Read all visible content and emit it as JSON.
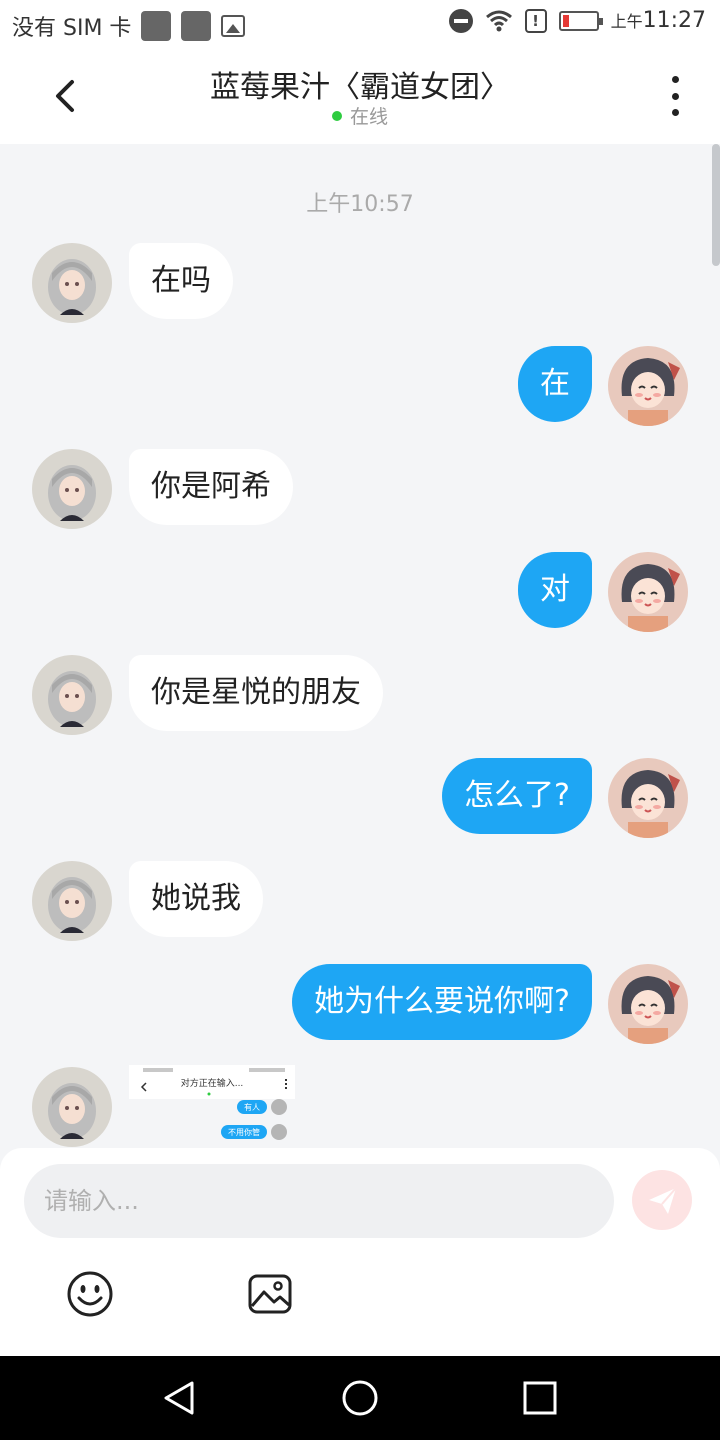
{
  "status_bar": {
    "carrier": "没有 SIM 卡",
    "ampm": "上午",
    "time": "11:27",
    "battery_color": "#e53935",
    "icons": [
      "sim-placeholder-icon",
      "sim-placeholder-icon",
      "image-icon",
      "do-not-disturb-icon",
      "wifi-icon",
      "warning-icon",
      "battery-low-icon"
    ]
  },
  "header": {
    "title": "蓝莓果汁〈霸道女团〉",
    "status": "在线",
    "status_color": "#2ecc40"
  },
  "chat": {
    "timestamp": "上午10:57",
    "messages": [
      {
        "side": "in",
        "text": "在吗"
      },
      {
        "side": "out",
        "text": "在"
      },
      {
        "side": "in",
        "text": "你是阿希"
      },
      {
        "side": "out",
        "text": "对"
      },
      {
        "side": "in",
        "text": "你是星悦的朋友"
      },
      {
        "side": "out",
        "text": "怎么了?"
      },
      {
        "side": "in",
        "text": "她说我"
      },
      {
        "side": "out",
        "text": "她为什么要说你啊?"
      }
    ],
    "screenshot_message": {
      "title": "对方正在输入...",
      "bubbles": [
        "有人",
        "不用你管"
      ]
    },
    "outgoing_bubble_color": "#1ea6f4",
    "incoming_bubble_color": "#ffffff"
  },
  "composer": {
    "placeholder": "请输入...",
    "send_icon": "send-icon",
    "emoji_icon": "smiley-icon",
    "image_icon": "image-icon"
  },
  "navbar": {
    "buttons": [
      "back-triangle-icon",
      "home-circle-icon",
      "recents-square-icon"
    ]
  }
}
